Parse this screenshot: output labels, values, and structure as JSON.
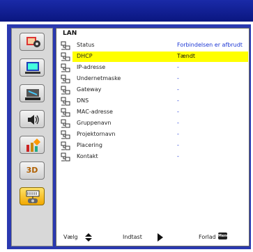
{
  "section_title": "LAN",
  "items": [
    {
      "label": "Status",
      "value": "Forbindelsen er afbrudt"
    },
    {
      "label": "DHCP",
      "value": "Tændt",
      "selected": true
    },
    {
      "label": "IP-adresse",
      "value": "-"
    },
    {
      "label": "Undernetmaske",
      "value": "-"
    },
    {
      "label": "Gateway",
      "value": "-"
    },
    {
      "label": "DNS",
      "value": "-"
    },
    {
      "label": "MAC-adresse",
      "value": "-"
    },
    {
      "label": "Gruppenavn",
      "value": "-"
    },
    {
      "label": "Projektornavn",
      "value": "-"
    },
    {
      "label": "Placering",
      "value": "-"
    },
    {
      "label": "Kontakt",
      "value": "-"
    }
  ],
  "footer": {
    "select_label": "Vælg",
    "enter_label": "Indtast",
    "exit_label": "Forlad",
    "menu_key_text": "Menu"
  },
  "sidebar_tabs": [
    {
      "icon": "image-settings-icon"
    },
    {
      "icon": "display-settings-icon"
    },
    {
      "icon": "setup-icon"
    },
    {
      "icon": "volume-icon"
    },
    {
      "icon": "options-icon"
    },
    {
      "icon": "3d-icon",
      "text": "3D"
    },
    {
      "icon": "lan-icon",
      "active": true
    }
  ],
  "colors": {
    "highlight": "#ffff00",
    "value_blue": "#1a35d4",
    "frame_blue": "#2a39b0",
    "active_tab": "#f2a800"
  }
}
